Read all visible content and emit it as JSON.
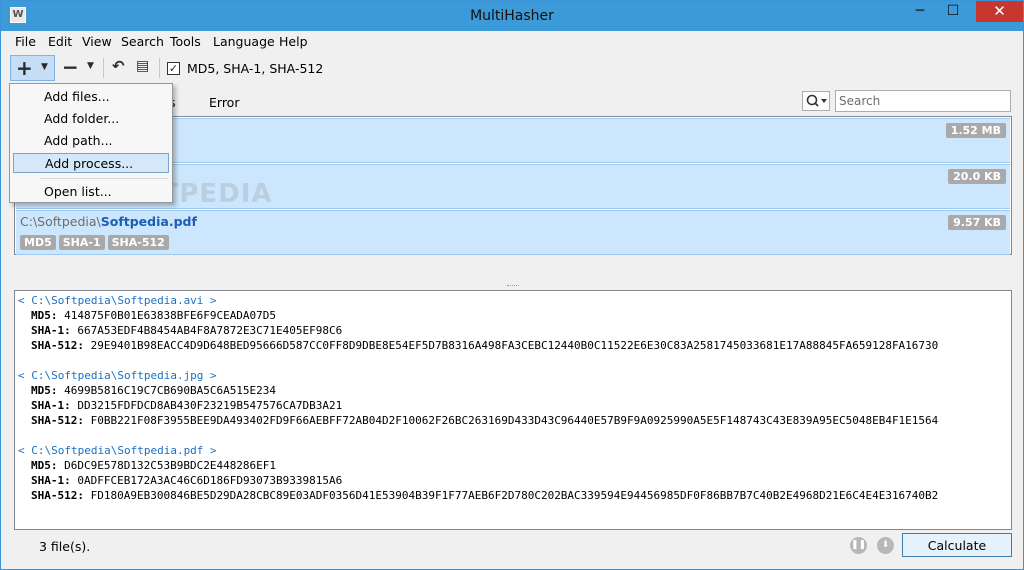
{
  "window": {
    "title": "MultiHasher",
    "app_icon": "W",
    "min": "─",
    "max": "☐",
    "close": "✕"
  },
  "menu": [
    "File",
    "Edit",
    "View",
    "Search",
    "Tools",
    "Language",
    "Help"
  ],
  "toolbar": {
    "hash_checked": true,
    "hash_label": "MD5, SHA-1, SHA-512"
  },
  "tabs": {
    "partial": "s",
    "error": "Error"
  },
  "search": {
    "placeholder": "Search"
  },
  "add_menu": {
    "items": [
      "Add files...",
      "Add folder...",
      "Add path...",
      "Add process...",
      "Open list..."
    ],
    "highlighted": "Add process..."
  },
  "watermark": "SOFTPEDIA",
  "files": [
    {
      "dir": "",
      "name": "",
      "size": "1.52 MB"
    },
    {
      "dir": "",
      "name": "",
      "size": "20.0 KB"
    },
    {
      "dir": "C:\\Softpedia\\",
      "name": "Softpedia.pdf",
      "size": "9.57 KB",
      "algos": [
        "MD5",
        "SHA-1",
        "SHA-512"
      ]
    }
  ],
  "output": [
    {
      "path": "< C:\\Softpedia\\Softpedia.avi >",
      "md5": "414875F0B01E63838BFE6F9CEADA07D5",
      "sha1": "667A53EDF4B8454AB4F8A7872E3C71E405EF98C6",
      "sha512": "29E9401B98EACC4D9D648BED95666D587CC0FF8D9DBE8E54EF5D7B8316A498FA3CEBC12440B0C11522E6E30C83A2581745033681E17A88845FA659128FA16730"
    },
    {
      "path": "< C:\\Softpedia\\Softpedia.jpg >",
      "md5": "4699B5816C19C7CB690BA5C6A515E234",
      "sha1": "DD3215FDFDCD8AB430F23219B547576CA7DB3A21",
      "sha512": "F0BB221F08F3955BEE9DA493402FD9F66AEBFF72AB04D2F10062F26BC263169D433D43C96440E57B9F9A0925990A5E5F148743C43E839A95EC5048EB4F1E1564"
    },
    {
      "path": "< C:\\Softpedia\\Softpedia.pdf >",
      "md5": "D6DC9E578D132C53B9BDC2E448286EF1",
      "sha1": "0ADFFCEB172A3AC46C6D186FD93073B9339815A6",
      "sha512": "FD180A9EB300846BE5D29DA28CBC89E03ADF0356D41E53904B39F1F77AEB6F2D780C202BAC339594E94456985DF0F86BB7B7C40B2E4968D21E6C4E4E316740B2"
    }
  ],
  "labels": {
    "md5": "MD5:",
    "sha1": "SHA-1:",
    "sha512": "SHA-512:"
  },
  "status": {
    "text": "3 file(s).",
    "calculate": "Calculate"
  }
}
